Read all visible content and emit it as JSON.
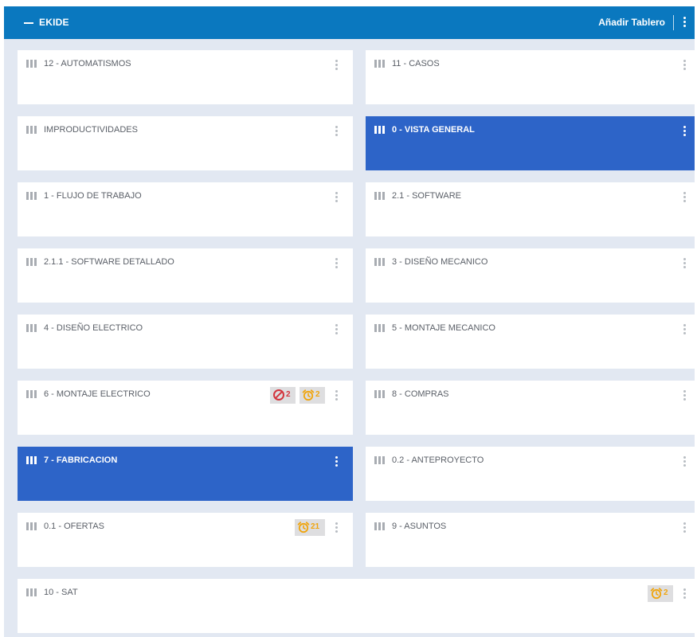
{
  "header": {
    "title": "EKIDE",
    "add_board_label": "Añadir Tablero",
    "collapse_icon": "minus-icon",
    "menu_icon": "vertical-dots-icon"
  },
  "colors": {
    "header": "#0a78bf",
    "active_card": "#2d64c8",
    "background": "#e2e8f2",
    "blocked": "#d3343d",
    "overdue": "#f0a50e"
  },
  "boards": [
    {
      "title": "12 - AUTOMATISMOS",
      "active": false,
      "icon": "board-columns-icon",
      "badges": []
    },
    {
      "title": "11 - CASOS",
      "active": false,
      "icon": "board-columns-icon",
      "badges": []
    },
    {
      "title": "IMPRODUCTIVIDADES",
      "active": false,
      "icon": "board-columns-icon",
      "badges": []
    },
    {
      "title": "0 - VISTA GENERAL",
      "active": true,
      "icon": "board-columns-icon",
      "badges": []
    },
    {
      "title": "1 - FLUJO DE TRABAJO",
      "active": false,
      "icon": "board-columns-icon",
      "badges": []
    },
    {
      "title": "2.1 - SOFTWARE",
      "active": false,
      "icon": "board-columns-icon",
      "badges": []
    },
    {
      "title": "2.1.1 - SOFTWARE DETALLADO",
      "active": false,
      "icon": "board-columns-icon",
      "badges": []
    },
    {
      "title": "3 - DISEÑO MECANICO",
      "active": false,
      "icon": "board-columns-icon",
      "badges": []
    },
    {
      "title": "4 - DISEÑO ELECTRICO",
      "active": false,
      "icon": "board-columns-icon",
      "badges": []
    },
    {
      "title": "5 - MONTAJE MECANICO",
      "active": false,
      "icon": "board-columns-icon",
      "badges": []
    },
    {
      "title": "6 - MONTAJE ELECTRICO",
      "active": false,
      "icon": "board-columns-icon",
      "badges": [
        {
          "type": "blocked",
          "icon": "blocked-icon",
          "count": "2"
        },
        {
          "type": "overdue",
          "icon": "alarm-clock-icon",
          "count": "2"
        }
      ]
    },
    {
      "title": "8 - COMPRAS",
      "active": false,
      "icon": "board-columns-icon",
      "badges": []
    },
    {
      "title": "7 - FABRICACION",
      "active": true,
      "icon": "board-columns-icon",
      "badges": []
    },
    {
      "title": "0.2 - ANTEPROYECTO",
      "active": false,
      "icon": "board-columns-icon",
      "badges": []
    },
    {
      "title": "0.1 - OFERTAS",
      "active": false,
      "icon": "board-columns-icon",
      "badges": [
        {
          "type": "overdue",
          "icon": "alarm-clock-icon",
          "count": "21"
        }
      ]
    },
    {
      "title": "9 - ASUNTOS",
      "active": false,
      "icon": "board-columns-icon",
      "badges": []
    },
    {
      "title": "10 - SAT",
      "active": false,
      "icon": "board-columns-icon",
      "badges": [
        {
          "type": "overdue",
          "icon": "alarm-clock-icon",
          "count": "2"
        }
      ]
    }
  ]
}
